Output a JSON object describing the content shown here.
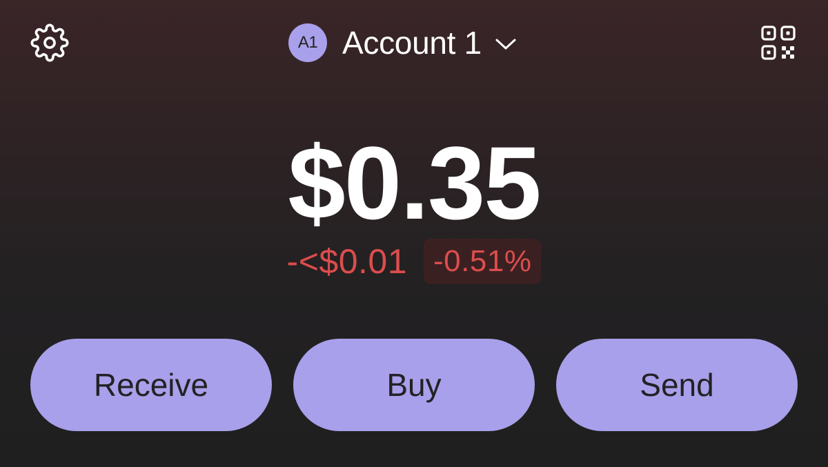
{
  "header": {
    "settings_icon": "gear-icon",
    "qr_icon": "qr-code-icon",
    "account": {
      "avatar_initials": "A1",
      "name": "Account 1",
      "dropdown_icon": "chevron-down-icon"
    }
  },
  "portfolio": {
    "balance": "$0.35",
    "change_amount": "-<$0.01",
    "change_percent": "-0.51%"
  },
  "actions": {
    "receive_label": "Receive",
    "buy_label": "Buy",
    "send_label": "Send"
  },
  "colors": {
    "accent": "#a8a0ea",
    "negative": "#dc4d4d",
    "negative_bg": "#3b2022",
    "button_text": "#232124"
  }
}
